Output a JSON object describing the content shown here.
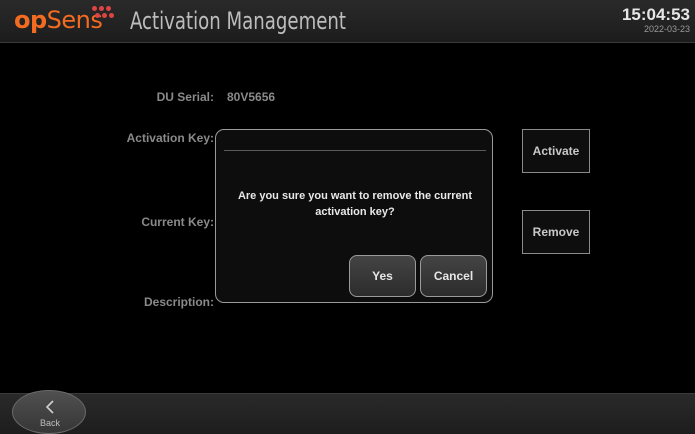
{
  "header": {
    "logo_op": "op",
    "logo_sens": "Sens",
    "title": "Activation Management",
    "time": "15:04:53",
    "date": "2022-03-23"
  },
  "form": {
    "du_serial_label": "DU Serial:",
    "du_serial_value": "80V5656",
    "activation_key_label": "Activation Key:",
    "current_key_label": "Current Key:",
    "description_label": "Description:"
  },
  "buttons": {
    "activate": "Activate",
    "remove": "Remove"
  },
  "dialog": {
    "message": "Are you sure you want to remove the current activation key?",
    "yes": "Yes",
    "cancel": "Cancel"
  },
  "footer": {
    "back_label": "Back"
  },
  "colors": {
    "brand_orange": "#f26b21",
    "background": "#000000",
    "header_bg": "#232323",
    "label_gray": "#8a8a8a"
  }
}
